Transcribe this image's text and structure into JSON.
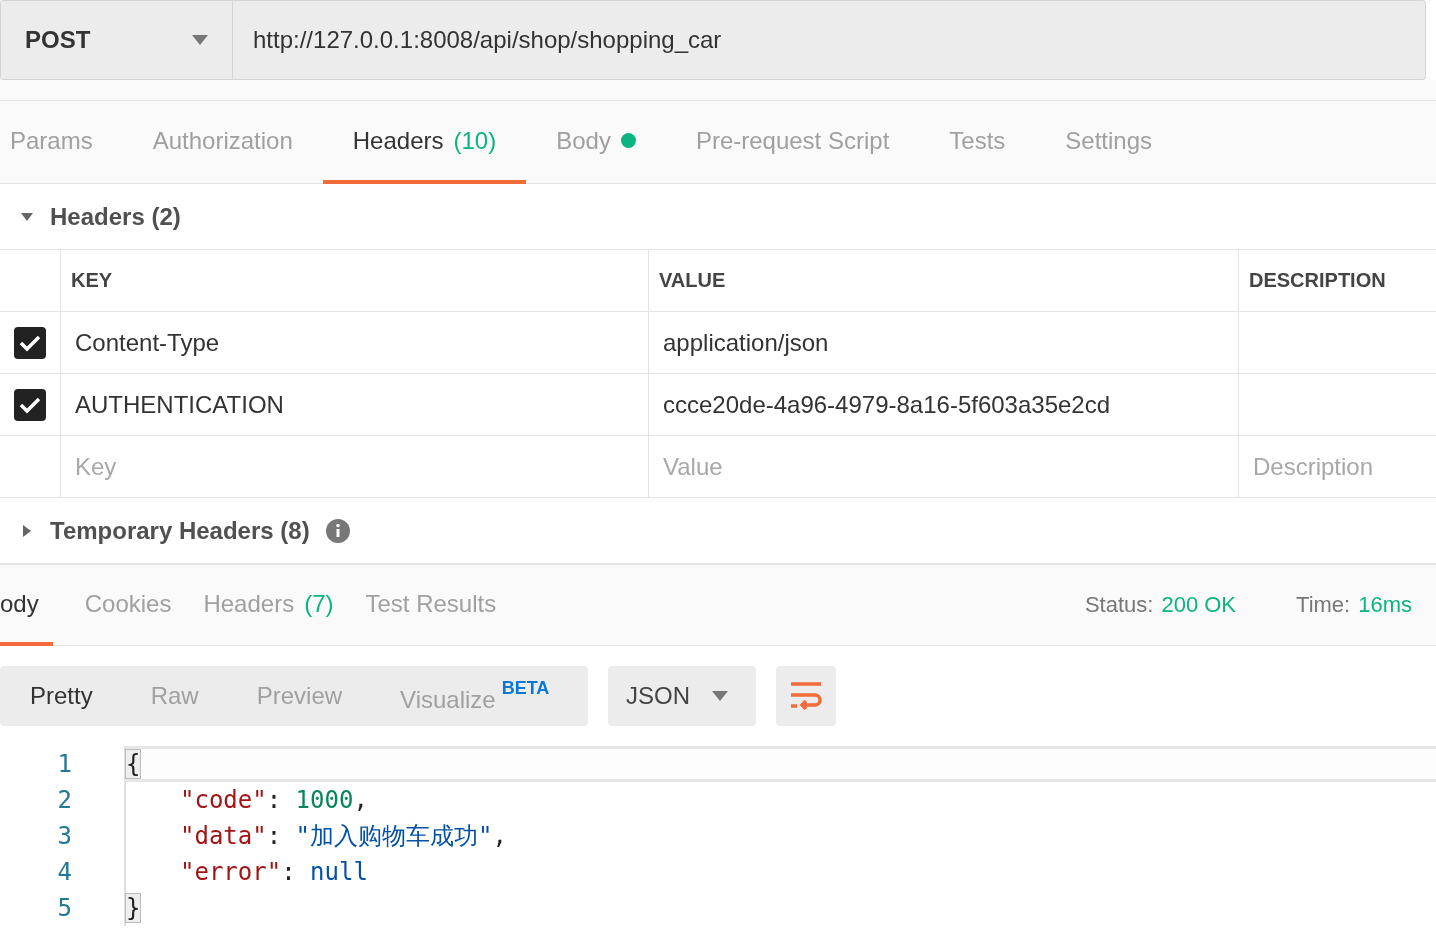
{
  "request": {
    "method": "POST",
    "url": "http://127.0.0.1:8008/api/shop/shopping_car"
  },
  "tabs": [
    {
      "label": "Params",
      "dot": false,
      "selected": false
    },
    {
      "label": "Authorization",
      "dot": false,
      "selected": false
    },
    {
      "label": "Headers",
      "count": "(10)",
      "dot": false,
      "selected": true
    },
    {
      "label": "Body",
      "dot": true,
      "selected": false
    },
    {
      "label": "Pre-request Script",
      "dot": false,
      "selected": false
    },
    {
      "label": "Tests",
      "dot": false,
      "selected": false
    },
    {
      "label": "Settings",
      "dot": false,
      "selected": false
    }
  ],
  "headers_section": {
    "title": "Headers (2)",
    "expanded": true
  },
  "table": {
    "columns": [
      "KEY",
      "VALUE",
      "DESCRIPTION"
    ],
    "rows": [
      {
        "key": "Content-Type",
        "value": "application/json",
        "checked": true
      },
      {
        "key": "AUTHENTICATION",
        "value": "ccce20de-4a96-4979-8a16-5f603a35e2cd",
        "checked": true
      }
    ],
    "placeholders": {
      "key": "Key",
      "value": "Value",
      "description": "Description"
    }
  },
  "temporary_section": {
    "title": "Temporary Headers (8)",
    "expanded": false
  },
  "response_tabs": [
    {
      "label": "ody",
      "selected": true
    },
    {
      "label": "Cookies",
      "selected": false
    },
    {
      "label": "Headers",
      "count": "(7)",
      "selected": false
    },
    {
      "label": "Test Results",
      "selected": false
    }
  ],
  "status": {
    "status_label": "Status:",
    "status_value": "200 OK",
    "time_label": "Time:",
    "time_value": "16ms"
  },
  "view_modes": [
    {
      "label": "Pretty",
      "selected": true
    },
    {
      "label": "Raw",
      "selected": false
    },
    {
      "label": "Preview",
      "selected": false
    },
    {
      "label": "Visualize",
      "badge": "BETA",
      "selected": false
    }
  ],
  "format": "JSON",
  "code": [
    {
      "number": "1",
      "active": true,
      "indented": false,
      "tokens": [
        {
          "kind": "bracket",
          "text": "{"
        }
      ]
    },
    {
      "number": "2",
      "active": false,
      "indented": true,
      "tokens": [
        {
          "kind": "key",
          "text": "\"code\""
        },
        {
          "kind": "punct",
          "text": ": "
        },
        {
          "kind": "number",
          "text": "1000"
        },
        {
          "kind": "punct",
          "text": ","
        }
      ]
    },
    {
      "number": "3",
      "active": false,
      "indented": true,
      "tokens": [
        {
          "kind": "key",
          "text": "\"data\""
        },
        {
          "kind": "punct",
          "text": ": "
        },
        {
          "kind": "string",
          "text": "\"加入购物车成功\""
        },
        {
          "kind": "punct",
          "text": ","
        }
      ]
    },
    {
      "number": "4",
      "active": false,
      "indented": true,
      "tokens": [
        {
          "kind": "key",
          "text": "\"error\""
        },
        {
          "kind": "punct",
          "text": ": "
        },
        {
          "kind": "null",
          "text": "null"
        }
      ]
    },
    {
      "number": "5",
      "active": false,
      "indented": false,
      "tokens": [
        {
          "kind": "bracket",
          "text": "}"
        }
      ]
    }
  ]
}
